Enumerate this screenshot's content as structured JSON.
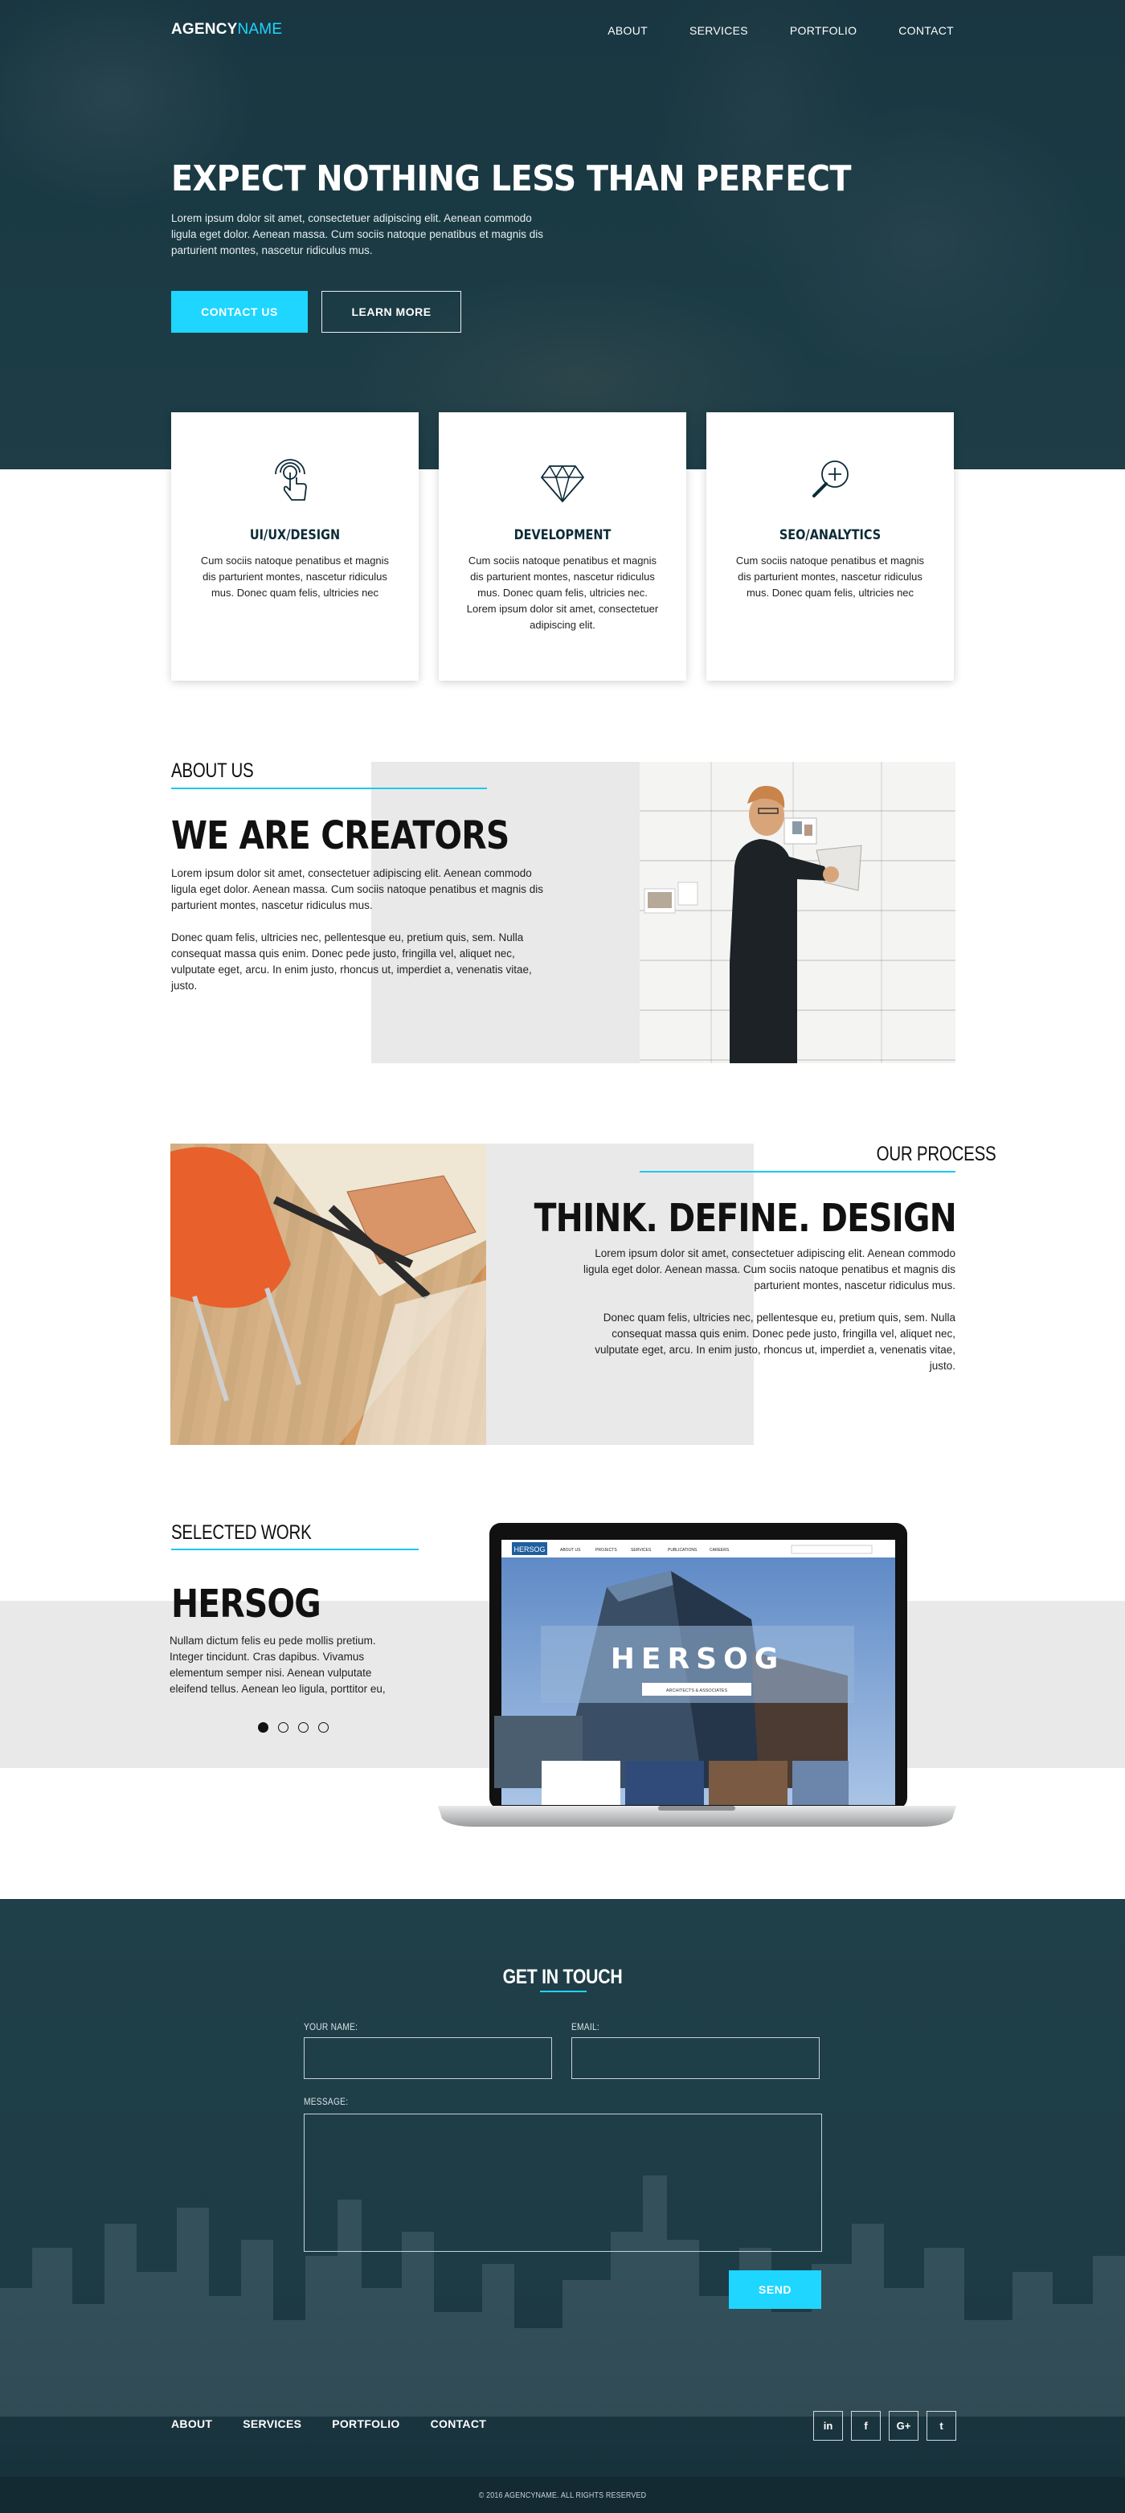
{
  "header": {
    "logo_bold": "AGENCY",
    "logo_accent": "NAME",
    "nav": [
      "ABOUT",
      "SERVICES",
      "PORTFOLIO",
      "CONTACT"
    ]
  },
  "hero": {
    "title": "EXPECT NOTHING LESS THAN PERFECT",
    "text": "Lorem ipsum dolor sit amet, consectetuer adipiscing elit. Aenean commodo ligula eget dolor. Aenean massa. Cum sociis natoque penatibus et magnis dis parturient montes, nascetur ridiculus mus.",
    "primary_button": "CONTACT US",
    "secondary_button": "LEARN MORE"
  },
  "services": [
    {
      "icon": "touch-icon",
      "title": "UI/UX/DESIGN",
      "text": "Cum sociis natoque penatibus et magnis dis parturient montes, nascetur ridiculus mus. Donec quam felis, ultricies nec"
    },
    {
      "icon": "diamond-icon",
      "title": "DEVELOPMENT",
      "text": "Cum sociis natoque penatibus et magnis dis parturient montes, nascetur ridiculus mus. Donec quam felis, ultricies nec. Lorem ipsum dolor sit amet, consectetuer adipiscing elit."
    },
    {
      "icon": "magnifier-plus-icon",
      "title": "SEO/ANALYTICS",
      "text": "Cum sociis natoque penatibus et magnis dis parturient montes, nascetur ridiculus mus. Donec quam felis, ultricies nec"
    }
  ],
  "about": {
    "label": "ABOUT US",
    "title": "WE ARE CREATORS",
    "para1": "Lorem ipsum dolor sit amet, consectetuer adipiscing elit. Aenean commodo ligula eget dolor. Aenean massa. Cum sociis natoque penatibus et magnis dis parturient montes, nascetur ridiculus mus.",
    "para2": "Donec quam felis, ultricies nec, pellentesque eu, pretium quis, sem. Nulla consequat massa quis enim. Donec pede justo, fringilla vel, aliquet nec, vulputate eget, arcu. In enim justo, rhoncus ut, imperdiet a, venenatis vitae, justo."
  },
  "process": {
    "label": "OUR PROCESS",
    "title": "THINK. DEFINE. DESIGN",
    "para1": "Lorem ipsum dolor sit amet, consectetuer adipiscing elit. Aenean commodo ligula eget dolor. Aenean massa. Cum sociis natoque penatibus et magnis dis parturient montes, nascetur ridiculus mus.",
    "para2": "Donec quam felis, ultricies nec, pellentesque eu, pretium quis, sem. Nulla consequat massa quis enim. Donec pede justo, fringilla vel, aliquet nec, vulputate eget, arcu. In enim justo, rhoncus ut, imperdiet a, venenatis vitae, justo."
  },
  "work": {
    "label": "SELECTED WORK",
    "title": "HERSOG",
    "text": "Nullam dictum felis eu pede mollis pretium. Integer tincidunt. Cras dapibus. Vivamus elementum semper nisi. Aenean vulputate eleifend tellus. Aenean leo ligula, porttitor eu,",
    "slides": 4,
    "active_slide": 1,
    "mockup": {
      "brand": "HERSOG",
      "nav": [
        "ABOUT US",
        "PROJECTS",
        "SERVICES",
        "PUBLICATIONS",
        "CAREERS"
      ],
      "hero_title": "HERSOG",
      "hero_sub": "ARCHITECTS & ASSOCIATES"
    }
  },
  "contact": {
    "title": "GET IN TOUCH",
    "name_label": "YOUR NAME:",
    "email_label": "EMAIL:",
    "message_label": "MESSAGE:",
    "send": "SEND"
  },
  "footer": {
    "nav": [
      "ABOUT",
      "SERVICES",
      "PORTFOLIO",
      "CONTACT"
    ],
    "socials": [
      {
        "icon": "linkedin-icon",
        "glyph": "in"
      },
      {
        "icon": "facebook-icon",
        "glyph": "f"
      },
      {
        "icon": "google-plus-icon",
        "glyph": "G+"
      },
      {
        "icon": "twitter-icon",
        "glyph": "t"
      }
    ],
    "copyright": "© 2016 AGENCYNAME. ALL RIGHTS RESERVED"
  },
  "colors": {
    "accent": "#1ed6ff",
    "dark": "#1f3f49",
    "grey_panel": "#e9e9e9"
  }
}
